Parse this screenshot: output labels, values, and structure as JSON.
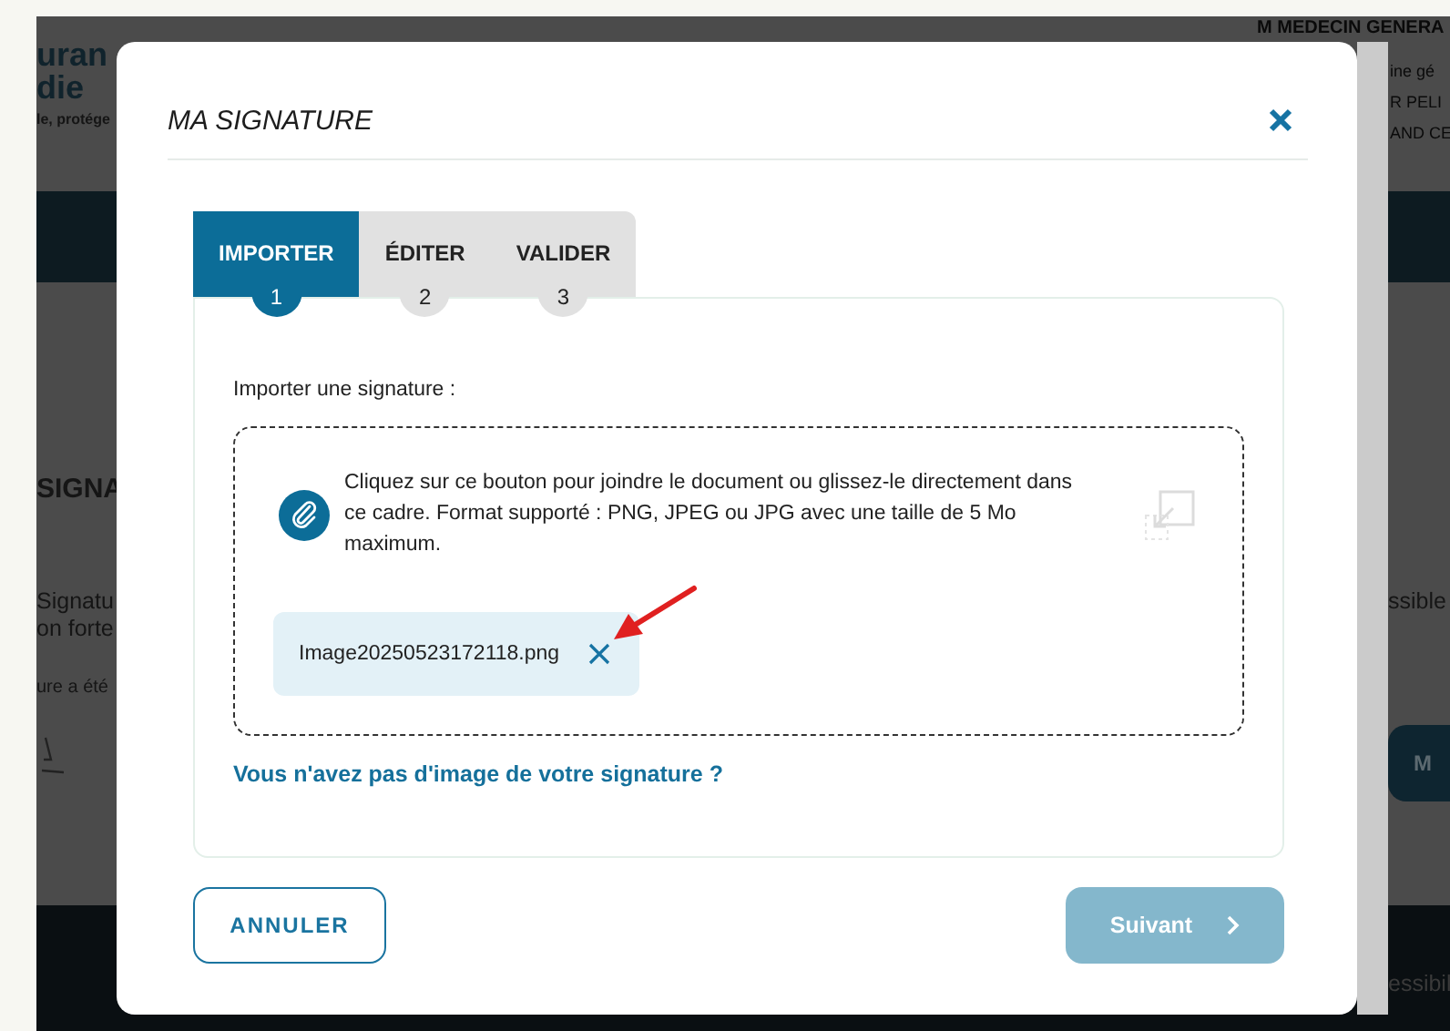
{
  "background": {
    "logo_lines": [
      "uran",
      "die"
    ],
    "tagline": "le, protége",
    "user_lines": [
      "M MEDECIN GENERA",
      "ine gé",
      "R PELI",
      "AND CE"
    ],
    "section_title": "SIGNA",
    "body_lines": [
      "Signatu",
      "on forte"
    ],
    "status_line": "ure a été",
    "right_text": "ssible",
    "right_button": "M",
    "footer_text": "essibil"
  },
  "dialog": {
    "title": "MA SIGNATURE",
    "steps": [
      {
        "label": "IMPORTER",
        "number": "1",
        "selected": true
      },
      {
        "label": "ÉDITER",
        "number": "2",
        "selected": false
      },
      {
        "label": "VALIDER",
        "number": "3",
        "selected": false
      }
    ],
    "field_label": "Importer une signature :",
    "dropzone": {
      "text": "Cliquez sur ce bouton pour joindre le document ou glissez-le directement dans ce cadre. Format supporté : PNG, JPEG ou JPG avec une taille de 5 Mo maximum."
    },
    "file": {
      "name": "Image20250523172118.png"
    },
    "help_link": "Vous n'avez pas d'image de votre signature ?",
    "cancel_button": {
      "label": "ANNULER"
    },
    "next_button": {
      "label": "Suivant",
      "disabled": true
    }
  }
}
